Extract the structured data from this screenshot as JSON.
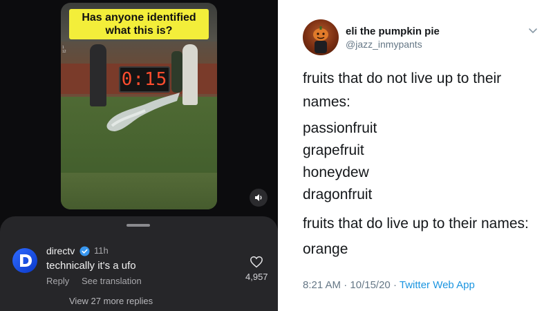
{
  "left_panel": {
    "video": {
      "caption": "Has anyone identified what this is?",
      "clock": "0:15",
      "scoreboard_small": [
        "1",
        "12"
      ]
    },
    "comment": {
      "username": "directv",
      "time": "11h",
      "text": "technically it's a ufo",
      "reply_label": "Reply",
      "translate_label": "See translation",
      "like_count": "4,957",
      "more_replies_label": "View 27 more replies",
      "avatar_letter": "D"
    },
    "icons": {
      "mute": "speaker-icon",
      "like": "heart-icon",
      "verified": "verified-badge-icon"
    }
  },
  "tweet": {
    "display_name": "eli the pumpkin pie",
    "handle": "@jazz_inmypants",
    "lines": [
      "fruits that do not live up to their",
      "names:",
      "passionfruit",
      "grapefruit",
      "honeydew",
      "dragonfruit",
      "fruits that do live up to their names:",
      "orange"
    ],
    "time": "8:21 AM",
    "date": "10/15/20",
    "separator": "·",
    "app": "Twitter Web App"
  },
  "colors": {
    "dark_bg": "#0c0c0e",
    "sheet_bg": "#262629",
    "caption_yellow": "#f3ee3a",
    "directv_blue": "#2f6bff",
    "twitter_blue": "#1b95e0",
    "tweet_text": "#14171a",
    "muted_text": "#657786"
  }
}
